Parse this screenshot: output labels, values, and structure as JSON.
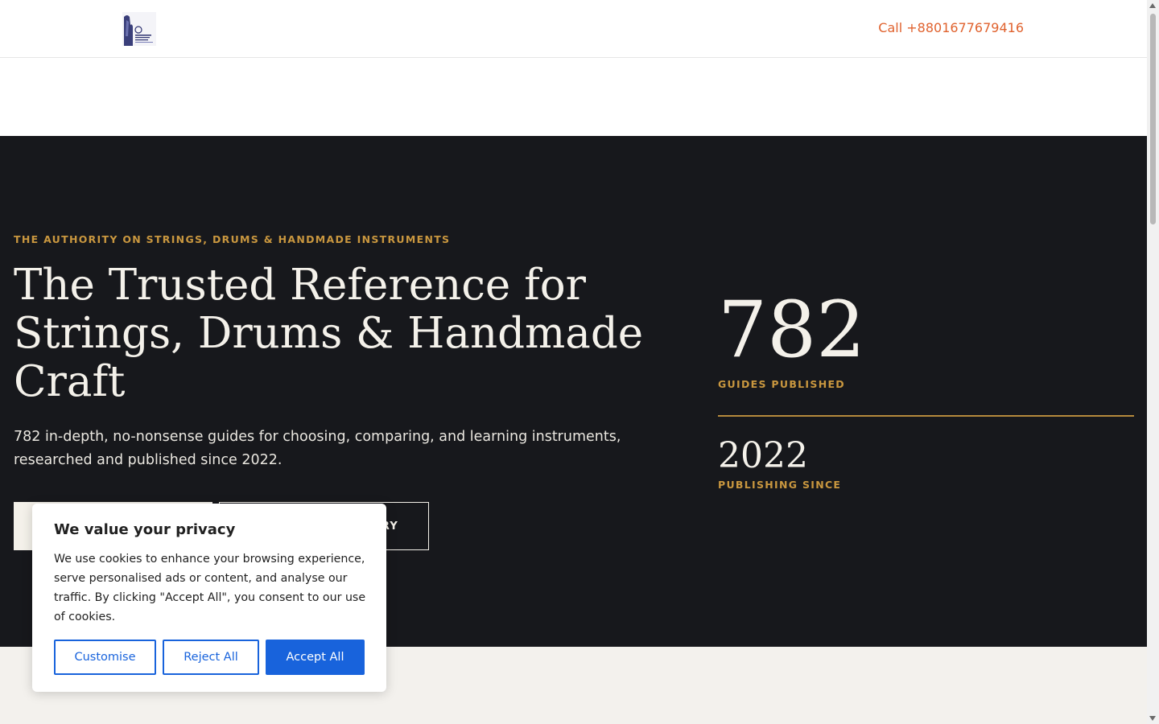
{
  "header": {
    "logo_alt": "Site logo",
    "call_text": "Call +8801677679416"
  },
  "hero": {
    "eyebrow": "THE AUTHORITY ON STRINGS, DRUMS & HANDMADE INSTRUMENTS",
    "title": "The Trusted Reference for Strings, Drums & Handmade Craft",
    "subtitle": "782 in-depth, no-nonsense guides for choosing, comparing, and learning instruments, researched and published since 2022.",
    "primary_button": "",
    "secondary_button": "RY",
    "stats": [
      {
        "value": "782",
        "label": "GUIDES PUBLISHED"
      },
      {
        "value": "2022",
        "label": "PUBLISHING SINCE"
      }
    ]
  },
  "cookie_banner": {
    "title": "We value your privacy",
    "text": "We use cookies to enhance your browsing experience, serve personalised ads or content, and analyse our traffic. By clicking \"Accept All\", you consent to our use of cookies.",
    "customise_label": "Customise",
    "reject_label": "Reject All",
    "accept_label": "Accept All"
  },
  "colors": {
    "accent": "#e0622e",
    "gold": "#c9973f",
    "hero_bg": "#17181c",
    "cookie_blue": "#1863dc"
  }
}
